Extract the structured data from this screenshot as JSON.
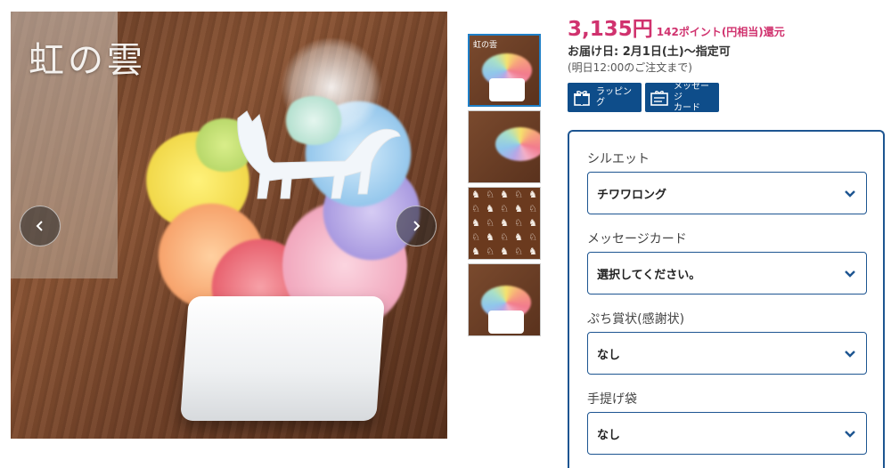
{
  "gallery": {
    "brand_text": "虹の雲",
    "prev_icon": "chevron-left-icon",
    "next_icon": "chevron-right-icon",
    "thumbnails": [
      {
        "label": "虹の雲",
        "active": true
      },
      {
        "label": "",
        "active": false
      },
      {
        "label": "",
        "active": false
      },
      {
        "label": "",
        "active": false
      }
    ]
  },
  "product": {
    "price": "3,135円",
    "points": "142ポイント(円相当)還元",
    "delivery": "お届け日: 2月1日(土)～指定可",
    "delivery_note": "(明日12:00のご注文まで)"
  },
  "services": {
    "wrapping": {
      "label": "ラッピング",
      "icon": "gift-icon"
    },
    "message_card": {
      "label_line1": "メッセージ",
      "label_line2": "カード",
      "icon": "card-icon"
    }
  },
  "options": [
    {
      "label": "シルエット",
      "value": "チワワロング"
    },
    {
      "label": "メッセージカード",
      "value": "選択してください。"
    },
    {
      "label": "ぷち賞状(感謝状)",
      "value": "なし"
    },
    {
      "label": "手提げ袋",
      "value": "なし"
    }
  ],
  "colors": {
    "price": "#d0326e",
    "accent_blue": "#0e4d8a",
    "border_blue": "#1d5591"
  }
}
